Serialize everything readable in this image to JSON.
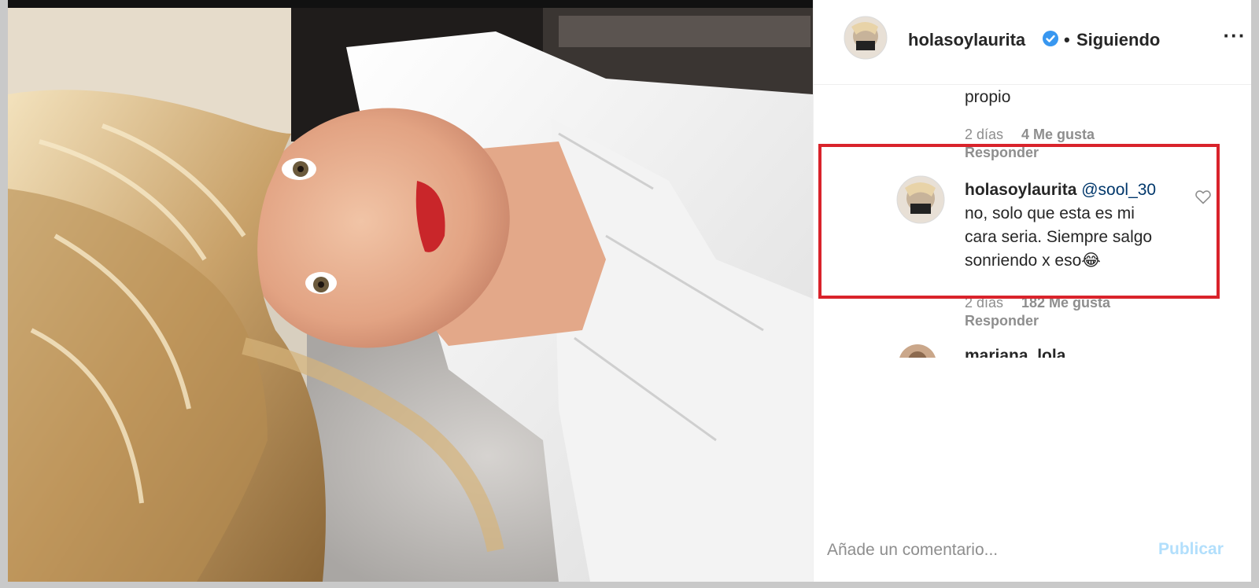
{
  "post": {
    "author": "holasoylaurita",
    "separator": "•",
    "follow_status": "Siguiendo",
    "more_icon": "more-options-icon",
    "verified_icon": "verified-badge-icon",
    "photo_description": "selfie-photo"
  },
  "comments": {
    "previous": {
      "text_tail": "propio",
      "time": "2 días",
      "likes": "4 Me gusta",
      "reply": "Responder"
    },
    "reply": {
      "username": "holasoylaurita",
      "mention": "@sool_30",
      "line1": "no, solo que esta es mi",
      "line2": "cara seria. Siempre salgo",
      "line3": "sonriendo x eso😂",
      "time": "2 días",
      "likes": "182 Me gusta",
      "reply": "Responder"
    },
    "next": {
      "username": "mariana_lola"
    }
  },
  "composer": {
    "placeholder": "Añade un comentario...",
    "publish_label": "Publicar"
  },
  "colors": {
    "highlight_border": "#d9232b",
    "mention": "#00376b",
    "verified": "#3897f0",
    "publish_disabled": "#b2dffc"
  }
}
